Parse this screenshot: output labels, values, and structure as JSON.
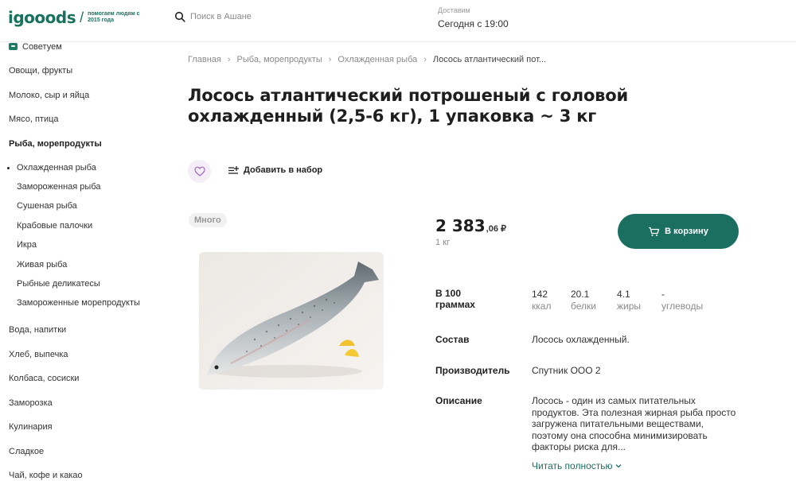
{
  "header": {
    "logo": "igooods",
    "tagline": "помогаем людям с 2015 года",
    "search_placeholder": "Поиск в Ашане",
    "delivery_label": "Доставим",
    "delivery_time": "Сегодня с 19:00"
  },
  "sidebar": {
    "advice": "Советуем",
    "categories_top": [
      "Овощи, фрукты",
      "Молоко, сыр и яйца",
      "Мясо, птица"
    ],
    "active_category": "Рыба, морепродукты",
    "subcategories": [
      "Охлажденная рыба",
      "Замороженная рыба",
      "Сушеная рыба",
      "Крабовые палочки",
      "Икра",
      "Живая рыба",
      "Рыбные деликатесы",
      "Замороженные морепродукты"
    ],
    "categories_bottom": [
      "Вода, напитки",
      "Хлеб, выпечка",
      "Колбаса, сосиски",
      "Заморозка",
      "Кулинария",
      "Сладкое",
      "Чай, кофе и какао"
    ]
  },
  "breadcrumb": [
    "Главная",
    "Рыба, морепродукты",
    "Охлажденная рыба",
    "Лосось атлантический пот..."
  ],
  "product": {
    "title": "Лосось атлантический потрошеный с головой охлажденный (2,5-6 кг), 1 упаковка ~ 3 кг",
    "add_to_set": "Добавить в набор",
    "stock_badge": "Много",
    "price_main": "2 383",
    "price_cents": ",06 ₽",
    "unit": "1 кг",
    "cart_button": "В корзину",
    "nutrition_label": "В 100 граммах",
    "nutrition": [
      {
        "value": "142",
        "unit": "ккал"
      },
      {
        "value": "20.1",
        "unit": "белки"
      },
      {
        "value": "4.1",
        "unit": "жиры"
      },
      {
        "value": "-",
        "unit": "углеводы"
      }
    ],
    "composition_label": "Состав",
    "composition": "Лосось охлажденный.",
    "producer_label": "Производитель",
    "producer": "Спутник ООО 2",
    "description_label": "Описание",
    "description": "Лосось - один из самых питательных продуктов. Эта полезная жирная рыба просто загружена питательными веществами, поэтому она способна минимизировать факторы риска для...",
    "read_more": "Читать полностью"
  },
  "colors": {
    "brand": "#18735e",
    "cart_button": "#1b6f61",
    "favorite_bg": "#f5eef7"
  },
  "icons": [
    "search-icon",
    "heart-icon",
    "add-to-set-icon",
    "cart-icon",
    "chevron-down-icon",
    "advice-icon"
  ]
}
